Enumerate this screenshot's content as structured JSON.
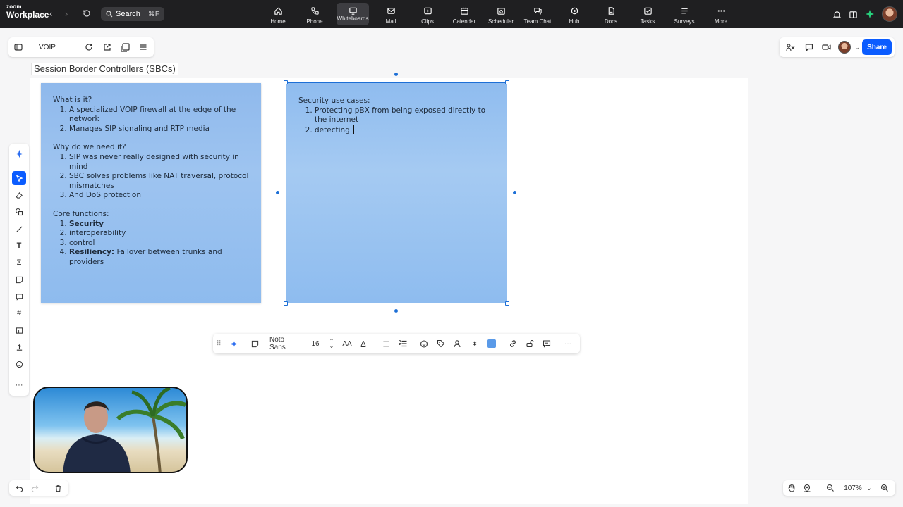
{
  "brand": {
    "line1": "zoom",
    "line2": "Workplace"
  },
  "search": {
    "label": "Search",
    "shortcut": "⌘F"
  },
  "apps": [
    {
      "label": "Home",
      "icon": "home-icon"
    },
    {
      "label": "Phone",
      "icon": "phone-icon"
    },
    {
      "label": "Whiteboards",
      "icon": "whiteboard-icon",
      "active": true
    },
    {
      "label": "Mail",
      "icon": "mail-icon"
    },
    {
      "label": "Clips",
      "icon": "clips-icon"
    },
    {
      "label": "Calendar",
      "icon": "calendar-icon"
    },
    {
      "label": "Scheduler",
      "icon": "scheduler-icon"
    },
    {
      "label": "Team Chat",
      "icon": "team-chat-icon"
    },
    {
      "label": "Hub",
      "icon": "hub-icon"
    },
    {
      "label": "Docs",
      "icon": "docs-icon"
    },
    {
      "label": "Tasks",
      "icon": "tasks-icon"
    },
    {
      "label": "Surveys",
      "icon": "surveys-icon"
    },
    {
      "label": "More",
      "icon": "more-icon"
    }
  ],
  "board": {
    "title": "VOIP"
  },
  "share": {
    "label": "Share"
  },
  "frame": {
    "title": "Session Border Controllers (SBCs)"
  },
  "note1": {
    "sections": [
      {
        "heading": "What is it?",
        "items": [
          "A specialized VOIP firewall at the edge of the network",
          "Manages SIP signaling and RTP media"
        ]
      },
      {
        "heading": "Why do we need it?",
        "items": [
          "SIP was never really designed with security in mind",
          "SBC solves problems like NAT traversal, protocol mismatches",
          "And DoS protection"
        ]
      },
      {
        "heading": "Core functions:",
        "items_rich": [
          {
            "bold": "Security",
            "rest": ""
          },
          {
            "bold": "",
            "rest": "interoperability"
          },
          {
            "bold": "",
            "rest": "control"
          },
          {
            "bold": "Resiliency:",
            "rest": " Failover between trunks and providers"
          }
        ]
      }
    ]
  },
  "note2": {
    "heading": "Security use cases:",
    "items": [
      "Protecting pBX from being exposed directly to the internet",
      "detecting "
    ]
  },
  "format_toolbar": {
    "font": "Noto Sans",
    "size": "16",
    "fill_color": "#5a9ae8"
  },
  "zoom": {
    "level": "107%"
  },
  "colors": {
    "accent": "#0b5cff",
    "note_blue": "#9ec4f0",
    "topbar": "#1f1f21"
  }
}
